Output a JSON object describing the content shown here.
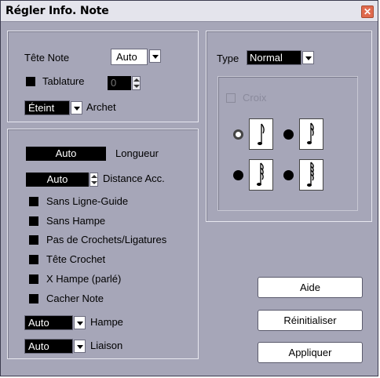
{
  "window": {
    "title": "Régler Info. Note",
    "close_icon": "close-icon"
  },
  "left_top": {
    "tete_note_label": "Tête Note",
    "tete_note_value": "Auto",
    "tablature_label": "Tablature",
    "tablature_value": "0",
    "archet_value": "Éteint",
    "archet_label": "Archet"
  },
  "left_bottom": {
    "longueur_value": "Auto",
    "longueur_label": "Longueur",
    "distance_value": "Auto",
    "distance_label": "Distance Acc.",
    "checkboxes": [
      "Sans Ligne-Guide",
      "Sans Hampe",
      "Pas de Crochets/Ligatures",
      "Tête Crochet",
      "X Hampe (parlé)",
      "Cacher Note"
    ],
    "hampe_value": "Auto",
    "hampe_label": "Hampe",
    "liaison_value": "Auto",
    "liaison_label": "Liaison"
  },
  "right": {
    "type_label": "Type",
    "type_value": "Normal",
    "croix_label": "Croix"
  },
  "buttons": {
    "aide": "Aide",
    "reinitialiser": "Réinitialiser",
    "appliquer": "Appliquer"
  },
  "colors": {
    "window_bg": "#a6a6b8",
    "titlebar_bg": "#e4e4ec",
    "close_bg": "#e06a4e"
  }
}
